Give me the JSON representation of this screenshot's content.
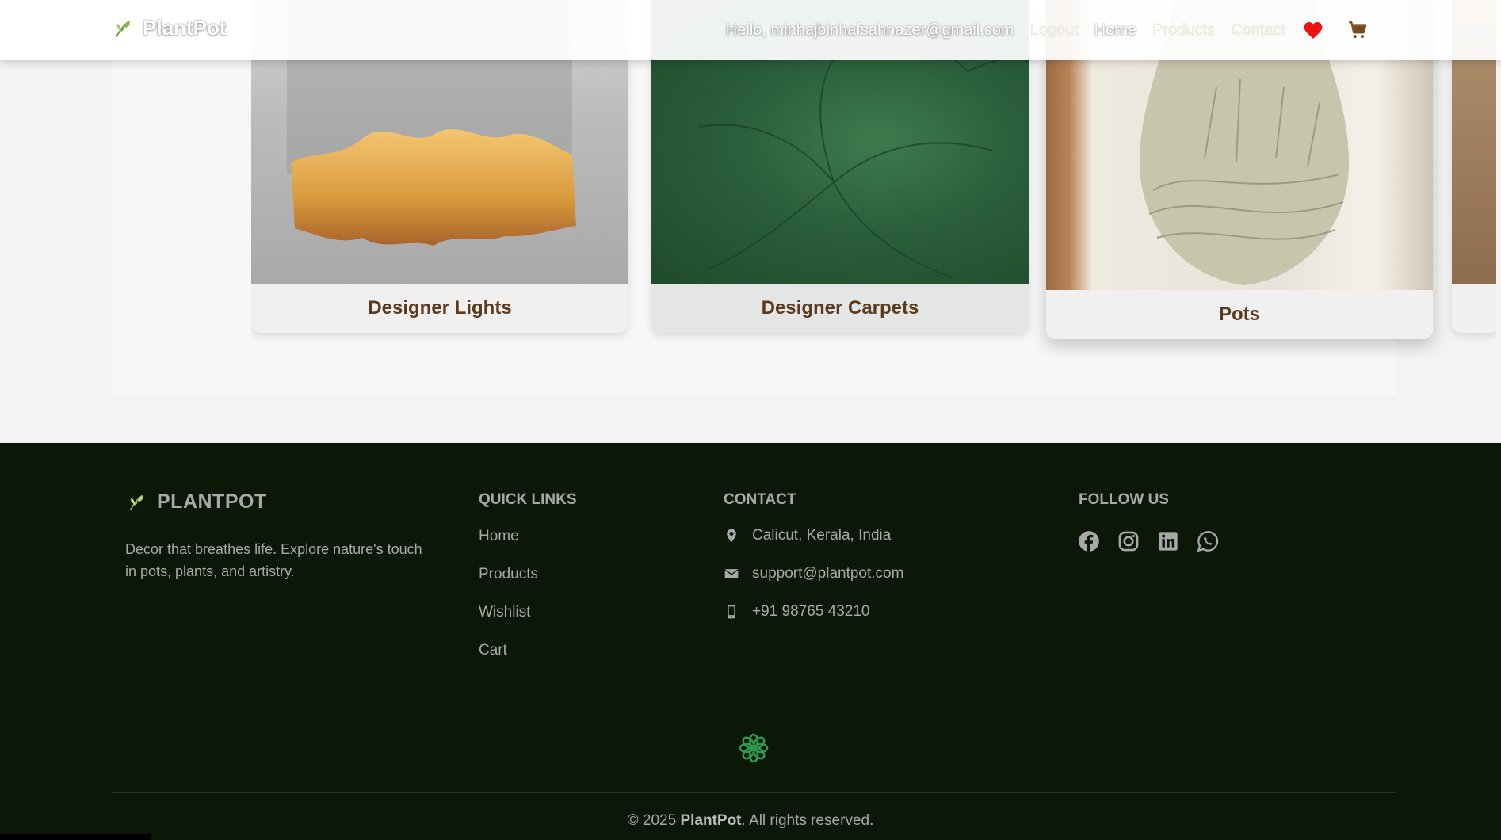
{
  "navbar": {
    "brand": "PlantPot",
    "greeting": "Hello, minhajbinhafsahnazer@gmail.com",
    "links": [
      "Logout",
      "Home",
      "Products",
      "Contact"
    ],
    "wishlist_icon": "heart-icon",
    "cart_icon": "cart-icon",
    "colors": {
      "heart": "#ee1111",
      "cart": "#7a4a1e"
    }
  },
  "carousel": {
    "cards": [
      {
        "label": "Designer Lights"
      },
      {
        "label": "Designer Carpets"
      },
      {
        "label": "Pots"
      }
    ]
  },
  "footer": {
    "brand": "PLANTPOT",
    "tagline": "Decor that breathes life. Explore nature's touch in pots, plants, and artistry.",
    "quick_links": {
      "heading": "QUICK LINKS",
      "items": [
        "Home",
        "Products",
        "Wishlist",
        "Cart"
      ]
    },
    "contact": {
      "heading": "CONTACT",
      "address": "Calicut, Kerala, India",
      "email": "support@plantpot.com",
      "phone": "+91 98765 43210"
    },
    "follow": {
      "heading": "FOLLOW US",
      "icons": [
        "facebook-icon",
        "instagram-icon",
        "linkedin-icon",
        "whatsapp-icon"
      ]
    },
    "copyright_prefix": "© 2025",
    "copyright_brand": "PlantPot",
    "copyright_suffix": ". All rights reserved.",
    "colors": {
      "background": "#0b1707",
      "accent": "#2f9a4f",
      "text": "#a8a8a8"
    }
  }
}
